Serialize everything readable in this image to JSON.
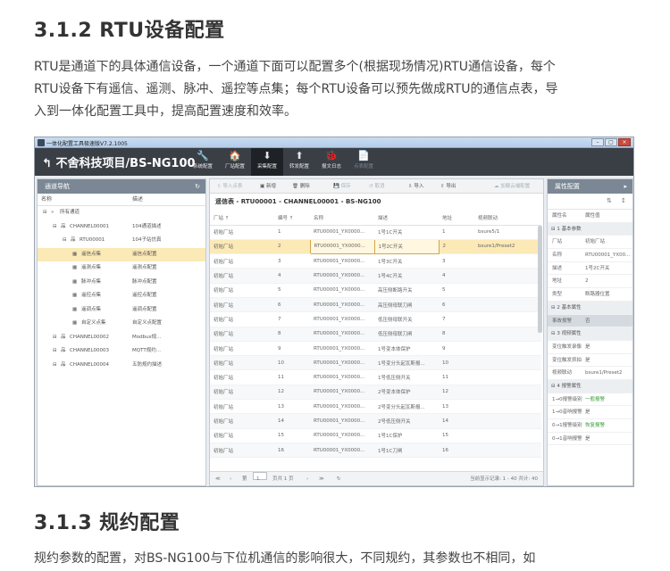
{
  "section1": {
    "heading": "3.1.2 RTU设备配置",
    "paragraph_lines": [
      "RTU是通道下的具体通信设备，一个通道下面可以配置多个(根据现场情况)RTU通信设备，每个",
      "RTU设备下有遥信、遥测、脉冲、遥控等点集；每个RTU设备可以预先做成RTU的通信点表，导",
      "入到一体化配置工具中，提高配置速度和效率。"
    ]
  },
  "section2": {
    "heading": "3.1.3 规约配置",
    "paragraph_line": "规约参数的配置，对BS-NG100与下位机通信的影响很大，不同规约，其参数也不相同，如"
  },
  "window": {
    "titlebar": "一体化配置工具极速版V7.2.1005",
    "app_title": "不舍科技项目/BS-NG100",
    "back_glyph": "↰",
    "nav": [
      {
        "icon": "🔧",
        "label": "系统配置",
        "state": "normal"
      },
      {
        "icon": "🏠",
        "label": "厂站配置",
        "state": "normal"
      },
      {
        "icon": "⬇",
        "label": "采集配置",
        "state": "active"
      },
      {
        "icon": "⬆",
        "label": "转发配置",
        "state": "normal"
      },
      {
        "icon": "🐞",
        "label": "报文日志",
        "state": "normal"
      },
      {
        "icon": "📄",
        "label": "点表配置",
        "state": "disabled"
      }
    ],
    "win_buttons": [
      "–",
      "▢",
      "×"
    ]
  },
  "left_panel": {
    "header": "通道导航",
    "refresh_glyph": "↻",
    "col_name": "名称",
    "col_desc": "描述",
    "tree": [
      {
        "name": "所有通道",
        "desc": "",
        "indent": 0,
        "icon": "folder"
      },
      {
        "name": "CHANNEL00001",
        "desc": "104通道描述",
        "indent": 1,
        "icon": "channel"
      },
      {
        "name": "RTU00001",
        "desc": "104子站仿真",
        "indent": 2,
        "icon": "rtu"
      },
      {
        "name": "遥信点集",
        "desc": "遥信点配置",
        "indent": 3,
        "icon": "set",
        "selected": true
      },
      {
        "name": "遥测点集",
        "desc": "遥测点配置",
        "indent": 3,
        "icon": "set"
      },
      {
        "name": "脉冲点集",
        "desc": "脉冲点配置",
        "indent": 3,
        "icon": "set"
      },
      {
        "name": "遥控点集",
        "desc": "遥控点配置",
        "indent": 3,
        "icon": "set"
      },
      {
        "name": "遥调点集",
        "desc": "遥调点配置",
        "indent": 3,
        "icon": "set"
      },
      {
        "name": "自定义点集",
        "desc": "自定义点配置",
        "indent": 3,
        "icon": "set"
      },
      {
        "name": "CHANNEL00002",
        "desc": "Modbus规...",
        "indent": 1,
        "icon": "channel"
      },
      {
        "name": "CHANNEL00003",
        "desc": "MQTT规约...",
        "indent": 1,
        "icon": "channel"
      },
      {
        "name": "CHANNEL00004",
        "desc": "五防规约描述",
        "indent": 1,
        "icon": "channel"
      }
    ]
  },
  "toolbar": [
    {
      "label": "导入点表",
      "dim": true
    },
    {
      "label": "新增",
      "dim": false
    },
    {
      "label": "删除",
      "dim": false
    },
    {
      "label": "保存",
      "dim": true
    },
    {
      "label": "取消",
      "dim": true
    },
    {
      "label": "导入",
      "dim": false
    },
    {
      "label": "导出",
      "dim": false
    },
    {
      "label": "加载云端配置",
      "dim": true
    }
  ],
  "grid": {
    "title": "遥信表 - RTU00001 - CHANNEL00001 - BS-NG100",
    "columns": [
      "厂站 ↑",
      "编号 ↑",
      "名称",
      "描述",
      "地址",
      "视频联动"
    ],
    "rows": [
      [
        "初始厂站",
        "1",
        "RTU00001_YX0000...",
        "1号1C开关",
        "1",
        "bsure5/1"
      ],
      [
        "初始厂站",
        "2",
        "RTU00001_YX0000...",
        "1号2C开关",
        "2",
        "bsure1/Preset2"
      ],
      [
        "初始厂站",
        "3",
        "RTU00001_YX0000...",
        "1号3C开关",
        "3",
        ""
      ],
      [
        "初始厂站",
        "4",
        "RTU00001_YX0000...",
        "1号4C开关",
        "4",
        ""
      ],
      [
        "初始厂站",
        "5",
        "RTU00001_YX0000...",
        "高压侧断路开关",
        "5",
        ""
      ],
      [
        "初始厂站",
        "6",
        "RTU00001_YX0000...",
        "高压侧母联刀闸",
        "6",
        ""
      ],
      [
        "初始厂站",
        "7",
        "RTU00001_YX0000...",
        "低压侧母联开关",
        "7",
        ""
      ],
      [
        "初始厂站",
        "8",
        "RTU00001_YX0000...",
        "低压侧母联刀闸",
        "8",
        ""
      ],
      [
        "初始厂站",
        "9",
        "RTU00001_YX0000...",
        "1号变本体保护",
        "9",
        ""
      ],
      [
        "初始厂站",
        "10",
        "RTU00001_YX0000...",
        "1号变分头起瓦斯报...",
        "10",
        ""
      ],
      [
        "初始厂站",
        "11",
        "RTU00001_YX0000...",
        "1号低压侧开关",
        "11",
        ""
      ],
      [
        "初始厂站",
        "12",
        "RTU00001_YX0000...",
        "2号变本体保护",
        "12",
        ""
      ],
      [
        "初始厂站",
        "13",
        "RTU00001_YX0000...",
        "2号变分头起瓦斯报...",
        "13",
        ""
      ],
      [
        "初始厂站",
        "14",
        "RTU00001_YX0000...",
        "2号低压侧开关",
        "14",
        ""
      ],
      [
        "初始厂站",
        "15",
        "RTU00001_YX0000...",
        "1号1C保护",
        "15",
        ""
      ],
      [
        "初始厂站",
        "16",
        "RTU00001_YX0000...",
        "1号1C刀闸",
        "16",
        ""
      ]
    ],
    "selected_row": 1
  },
  "pager": {
    "nav_glyphs": [
      "≪",
      "‹",
      "›",
      "≫",
      "↻"
    ],
    "page_label": "第",
    "page_value": "1",
    "page_total": "页共 1 页",
    "summary": "当前显示记录: 1 - 40 共计: 40"
  },
  "right_panel": {
    "header": "属性配置",
    "arrow_glyph": "▸",
    "sort_glyphs": [
      "⇅",
      "↕"
    ],
    "col_name": "属性名",
    "col_value": "属性值",
    "rows": [
      {
        "type": "group",
        "label": "1 基本参数"
      },
      {
        "type": "prop",
        "k": "厂站",
        "v": "初始厂站"
      },
      {
        "type": "prop",
        "k": "名称",
        "v": "RTU00001_YX00..."
      },
      {
        "type": "prop",
        "k": "描述",
        "v": "1号2C开关"
      },
      {
        "type": "prop",
        "k": "地址",
        "v": "2"
      },
      {
        "type": "prop",
        "k": "类型",
        "v": "断路器位置"
      },
      {
        "type": "group",
        "label": "2 基本属性"
      },
      {
        "type": "prop",
        "k": "事故报警",
        "v": "否",
        "hl": true
      },
      {
        "type": "group",
        "label": "3 视频属性"
      },
      {
        "type": "prop",
        "k": "变位触发录像",
        "v": "是"
      },
      {
        "type": "prop",
        "k": "变位触发抓拍",
        "v": "是"
      },
      {
        "type": "prop",
        "k": "视频联动",
        "v": "bsure1/Preset2"
      },
      {
        "type": "group",
        "label": "4 报警属性"
      },
      {
        "type": "prop",
        "k": "1→0报警级别",
        "v": "一般报警",
        "green": true
      },
      {
        "type": "prop",
        "k": "1→0音响报警",
        "v": "是"
      },
      {
        "type": "prop",
        "k": "0→1报警级别",
        "v": "恢复报警",
        "green": true
      },
      {
        "type": "prop",
        "k": "0→1音响报警",
        "v": "是"
      }
    ]
  }
}
